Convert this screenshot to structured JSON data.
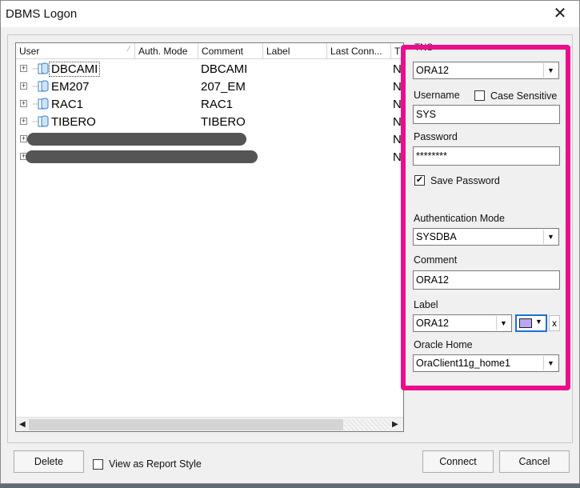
{
  "window": {
    "title": "DBMS Logon",
    "close_glyph": "✕"
  },
  "list": {
    "columns": [
      {
        "label": "User"
      },
      {
        "label": "Auth. Mode"
      },
      {
        "label": "Comment"
      },
      {
        "label": "Label"
      },
      {
        "label": "Last Conn..."
      },
      {
        "label": "T"
      }
    ],
    "rows": [
      {
        "user": "DBCAMI",
        "comment": "DBCAMI",
        "tail": "N"
      },
      {
        "user": "EM207",
        "comment": "207_EM",
        "tail": "N"
      },
      {
        "user": "RAC1",
        "comment": "RAC1",
        "tail": "N"
      },
      {
        "user": "TIBERO",
        "comment": "TIBERO",
        "tail": "N"
      },
      {
        "user": "",
        "comment": "",
        "tail": "N",
        "redacted": true
      },
      {
        "user": "",
        "comment": "",
        "tail": "N",
        "redacted": true
      }
    ]
  },
  "form": {
    "tns_label": "TNS",
    "tns_value": "ORA12",
    "username_label": "Username",
    "case_sensitive_label": "Case Sensitive",
    "username_value": "SYS",
    "password_label": "Password",
    "password_value": "********",
    "save_password_label": "Save Password",
    "save_password_checked": "✔",
    "auth_mode_label": "Authentication Mode",
    "auth_mode_value": "SYSDBA",
    "comment_label": "Comment",
    "comment_value": "ORA12",
    "label_label": "Label",
    "label_value": "ORA12",
    "label_color": "#b9a7f5",
    "clear_label_glyph": "x",
    "oracle_home_label": "Oracle Home",
    "oracle_home_value": "OraClient11g_home1"
  },
  "footer": {
    "delete_label": "Delete",
    "report_style_label": "View as Report Style",
    "connect_label": "Connect",
    "cancel_label": "Cancel"
  },
  "colors": {
    "highlight": "#ea0d8c"
  },
  "icons": {
    "expander": "+",
    "dropdown": "▼",
    "scroll_left": "◀",
    "scroll_right": "▶"
  }
}
